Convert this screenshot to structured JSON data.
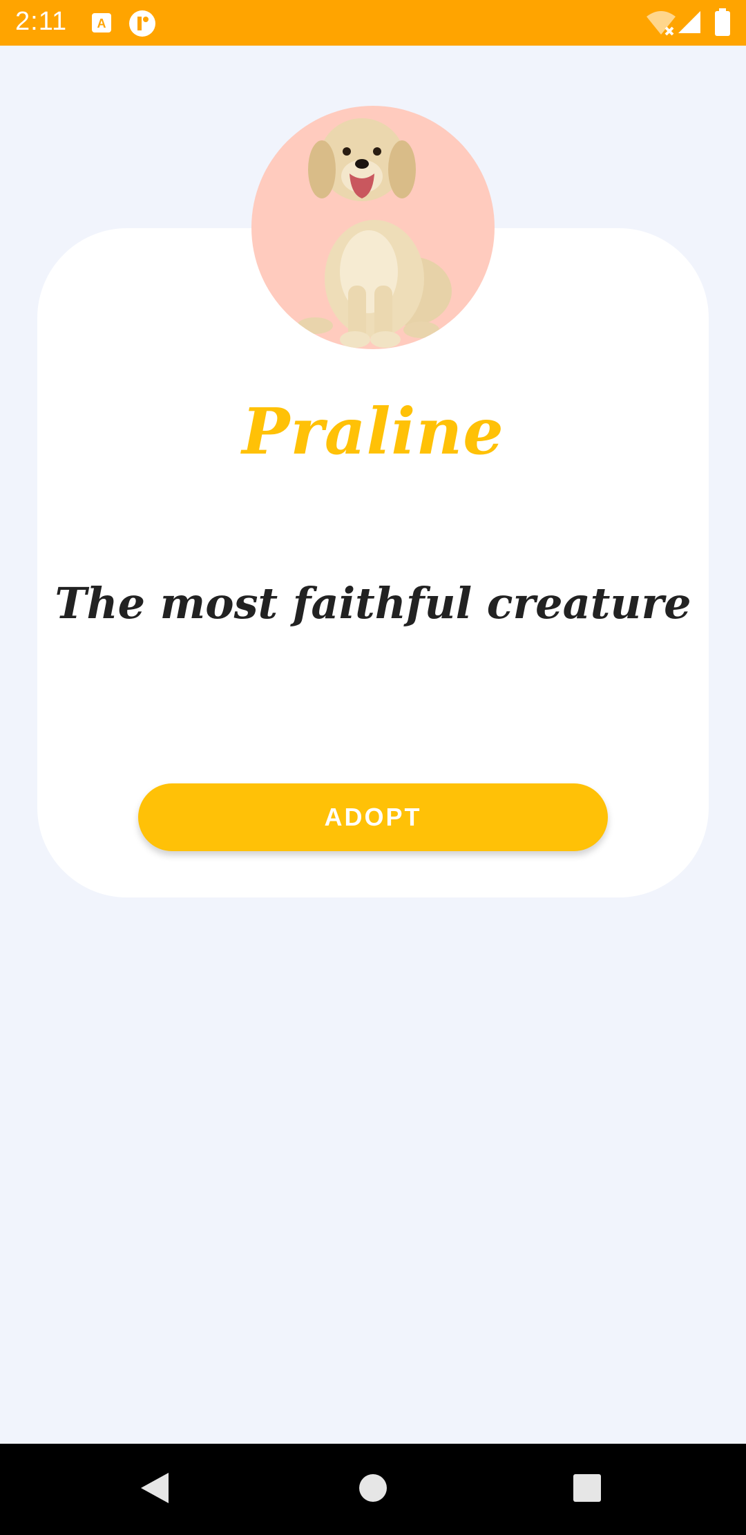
{
  "status_bar": {
    "time": "2:11",
    "icons": [
      "keyboard-a-icon",
      "app-notification-icon",
      "wifi-off-icon",
      "signal-icon",
      "battery-icon"
    ],
    "color": "#FFA400"
  },
  "pet": {
    "name": "Praline",
    "tagline": "The most faithful creature",
    "avatar_bg": "#FFCBBE"
  },
  "actions": {
    "adopt_label": "ADOPT"
  },
  "colors": {
    "accent": "#FFC107",
    "background": "#F1F4FC",
    "card": "#FFFFFF"
  },
  "nav_bar": {
    "icons": [
      "back-icon",
      "home-icon",
      "recents-icon"
    ]
  }
}
